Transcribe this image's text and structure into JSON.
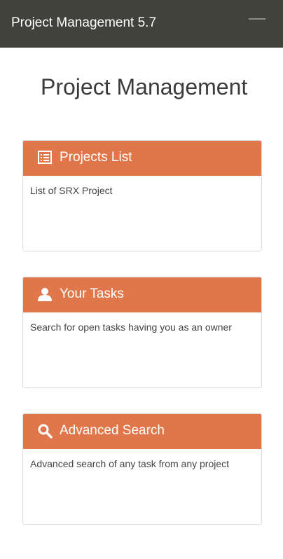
{
  "header": {
    "title": "Project Management 5.7",
    "menu_icon": "hamburger-menu-icon"
  },
  "page": {
    "title": "Project Management"
  },
  "cards": [
    {
      "title": "Projects List",
      "icon": "list-icon",
      "description": "List of SRX Project"
    },
    {
      "title": "Your Tasks",
      "icon": "user-icon",
      "description": "Search for open tasks having you as an owner"
    },
    {
      "title": "Advanced Search",
      "icon": "search-icon",
      "description": "Advanced search of any task from any project"
    }
  ],
  "colors": {
    "navbar": "#42423d",
    "card_header": "#e0774b",
    "card_border": "#dcdcdc"
  }
}
